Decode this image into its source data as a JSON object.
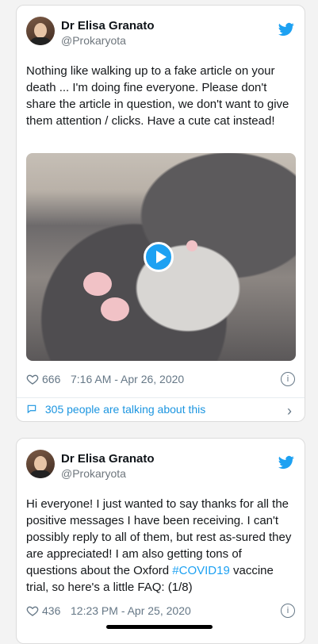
{
  "tweets": [
    {
      "author": {
        "name": "Dr Elisa Granato",
        "handle": "@Prokaryota"
      },
      "text": "Nothing like walking up to a fake article on your death ... I'm doing fine everyone. Please don't share the article in question, we don't want to give them attention / clicks. Have a cute cat instead!",
      "likes": "666",
      "timestamp": "7:16 AM - Apr 26, 2020",
      "talking": "305 people are talking about this",
      "media": {
        "type": "video",
        "icon": "play-icon",
        "description_icon": "cat-video"
      }
    },
    {
      "author": {
        "name": "Dr Elisa Granato",
        "handle": "@Prokaryota"
      },
      "text_before_hashtag": "Hi everyone! I just wanted to say thanks for all the positive messages I have been receiving. I can't possibly reply to all of them, but rest as-sured they are appreciated! I am also getting tons of questions about the Oxford ",
      "hashtag": "#COVID19",
      "text_after_hashtag": " vaccine trial, so here's a little FAQ: (1/8)",
      "likes": "436",
      "timestamp": "12:23 PM - Apr 25, 2020"
    }
  ],
  "colors": {
    "accent": "#1da1f2",
    "muted": "#657786",
    "background": "#f3f3f3"
  },
  "icons": {
    "brand": "twitter-bird-icon",
    "like": "heart-icon",
    "info": "info-icon",
    "reply": "chat-bubble-icon",
    "chevron": "chevron-right-icon"
  },
  "info_glyph": "i",
  "chevron_glyph": "›"
}
